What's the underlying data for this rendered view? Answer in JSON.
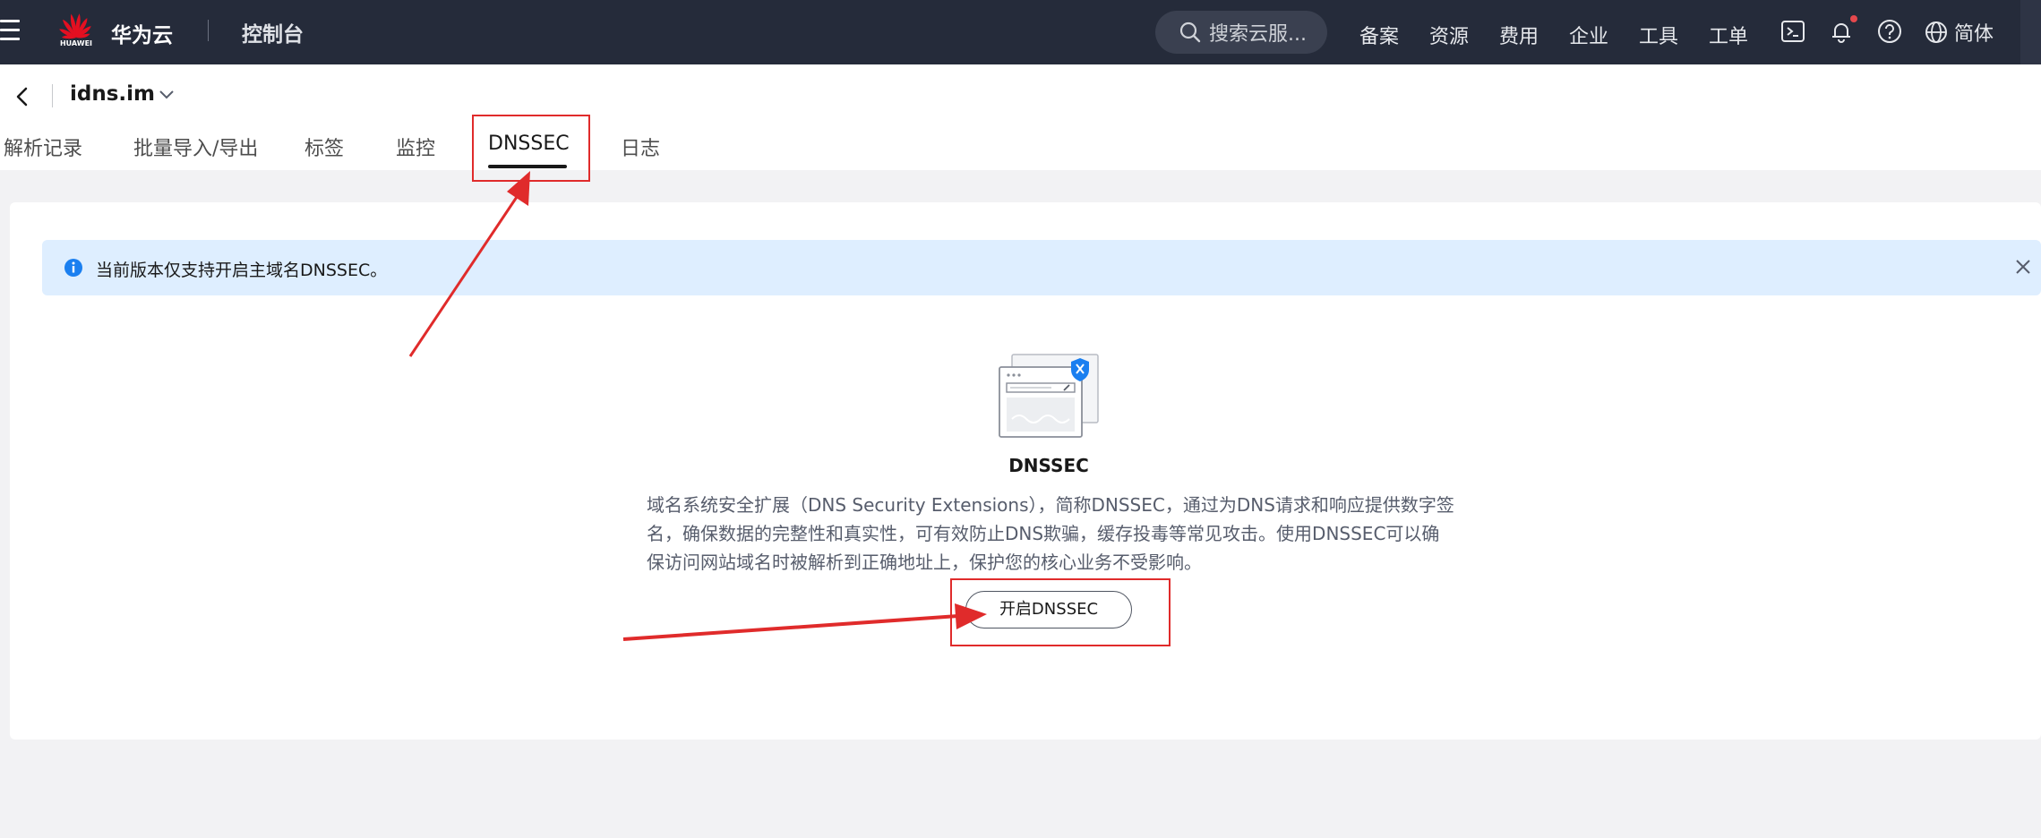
{
  "topbar": {
    "brand": "华为云",
    "logo_text": "HUAWEI",
    "console": "控制台",
    "search_placeholder": "搜索云服...",
    "nav": [
      "备案",
      "资源",
      "费用",
      "企业",
      "工具",
      "工单"
    ],
    "lang": "简体",
    "icons": [
      "menu-icon",
      "search-icon",
      "terminal-icon",
      "bell-icon",
      "help-icon",
      "globe-icon"
    ]
  },
  "header": {
    "domain": "idns.im",
    "tabs": [
      "解析记录",
      "批量导入/导出",
      "标签",
      "监控",
      "DNSSEC",
      "日志"
    ],
    "active_tab": "DNSSEC"
  },
  "alert": {
    "text": "当前版本仅支持开启主域名DNSSEC。"
  },
  "empty_state": {
    "title": "DNSSEC",
    "description": "域名系统安全扩展（DNS Security Extensions），简称DNSSEC，通过为DNS请求和响应提供数字签名，确保数据的完整性和真实性，可有效防止DNS欺骗，缓存投毒等常见攻击。使用DNSSEC可以确保访问网站域名时被解析到正确地址上，保护您的核心业务不受影响。",
    "button": "开启DNSSEC"
  },
  "colors": {
    "topbar_bg": "#252b3a",
    "alert_bg": "#deeeff",
    "info_blue": "#1a7ff0",
    "annotation_red": "#e02b2b"
  }
}
